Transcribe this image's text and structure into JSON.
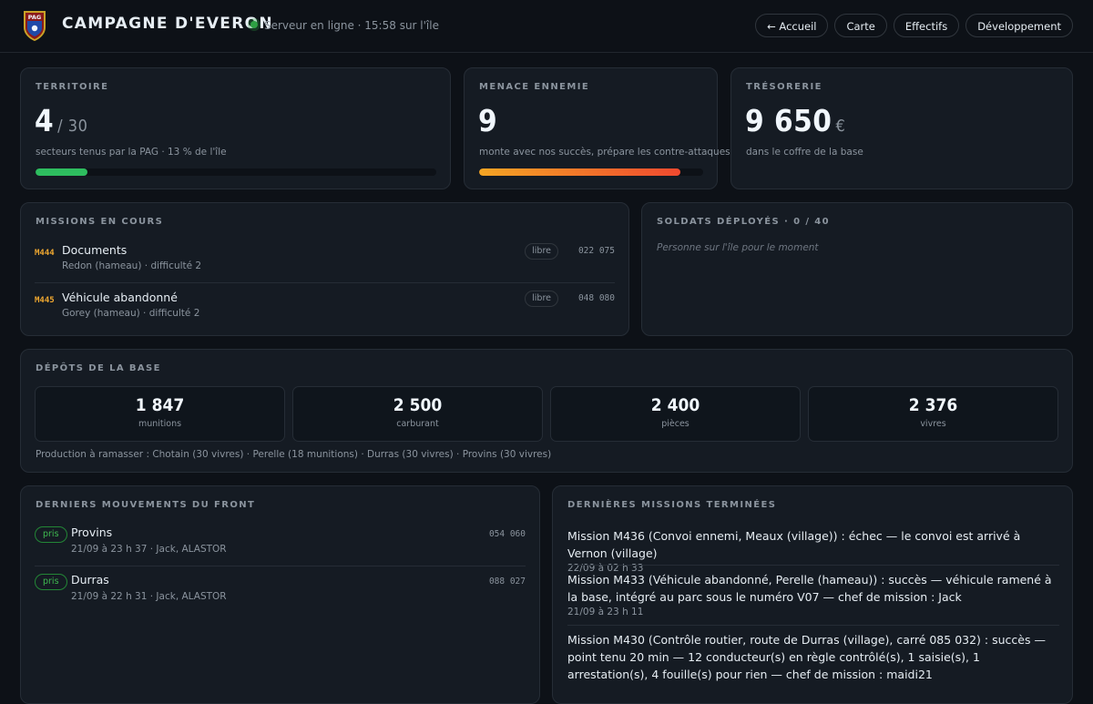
{
  "header": {
    "logo_text": "PAG",
    "title": "CAMPAGNE D'EVERON",
    "status": "Serveur en ligne · 15:58 sur l'île",
    "nav": [
      "← Accueil",
      "Carte",
      "Effectifs",
      "Développement"
    ]
  },
  "colors": {
    "background": "#0d1117",
    "card": "#151b23",
    "online": "#2ea043",
    "mission_code": "#f0a830",
    "territory_bar": "#2ebd5f",
    "threat_bar_start": "#f5a524",
    "threat_bar_end": "#f0492f"
  },
  "territoire": {
    "title": "TERRITOIRE",
    "value": "4",
    "total": "/ 30",
    "sub": "secteurs tenus par la PAG · 13 % de l'île",
    "progress": 0.13
  },
  "menace": {
    "title": "MENACE ENNEMIE",
    "value": "9",
    "sub": "monte avec nos succès, prépare les contre-attaques",
    "progress": 0.9
  },
  "tresorerie": {
    "title": "TRÉSORERIE",
    "value": "9 650",
    "unit": "€",
    "sub": "dans le coffre de la base"
  },
  "missions": {
    "title": "MISSIONS EN COURS",
    "items": [
      {
        "code": "M444",
        "name": "Documents",
        "sub": "Redon (hameau) · difficulté 2",
        "status": "libre",
        "grid": "022 075"
      },
      {
        "code": "M445",
        "name": "Véhicule abandonné",
        "sub": "Gorey (hameau) · difficulté 2",
        "status": "libre",
        "grid": "048 080"
      }
    ]
  },
  "soldats": {
    "title": "SOLDATS DÉPLOYÉS · 0 / 40",
    "empty": "Personne sur l'île pour le moment"
  },
  "depots": {
    "title": "DÉPÔTS DE LA BASE",
    "items": [
      {
        "value": "1 847",
        "label": "munitions"
      },
      {
        "value": "2 500",
        "label": "carburant"
      },
      {
        "value": "2 400",
        "label": "pièces"
      },
      {
        "value": "2 376",
        "label": "vivres"
      }
    ],
    "production": "Production à ramasser : Chotain (30 vivres) · Perelle (18 munitions) · Durras (30 vivres) · Provins (30 vivres)"
  },
  "front": {
    "title": "DERNIERS MOUVEMENTS DU FRONT",
    "items": [
      {
        "tag": "pris",
        "name": "Provins",
        "sub": "21/09 à 23 h 37 · Jack, ALASTOR",
        "grid": "054 060"
      },
      {
        "tag": "pris",
        "name": "Durras",
        "sub": "21/09 à 22 h 31 · Jack, ALASTOR",
        "grid": "088 027"
      }
    ]
  },
  "terminees": {
    "title": "DERNIÈRES MISSIONS TERMINÉES",
    "items": [
      {
        "text": "Mission M436 (Convoi ennemi, Meaux (village)) : échec — le convoi est arrivé à Vernon (village)",
        "date": "22/09 à 02 h 33"
      },
      {
        "text": "Mission M433 (Véhicule abandonné, Perelle (hameau)) : succès — véhicule ramené à la base, intégré au parc sous le numéro V07 — chef de mission : Jack",
        "date": "21/09 à 23 h 11"
      },
      {
        "text": "Mission M430 (Contrôle routier, route de Durras (village), carré 085 032) : succès — point tenu 20 min — 12 conducteur(s) en règle contrôlé(s), 1 saisie(s), 1 arrestation(s), 4 fouille(s) pour rien — chef de mission : maidi21",
        "date": ""
      }
    ]
  }
}
